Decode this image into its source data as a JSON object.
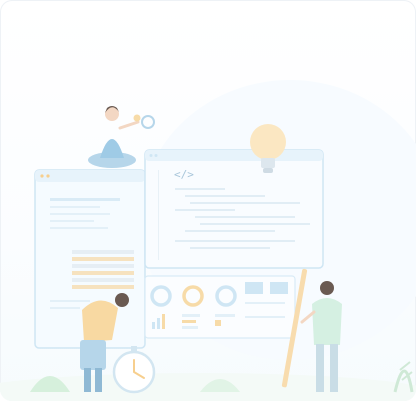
{
  "illustration": {
    "code_glyph": "</>",
    "palette": {
      "window_border": "#cfe6f4",
      "window_fill": "#f5fbff",
      "window_header": "#e7f3fb",
      "accent_orange": "#f7cf8e",
      "accent_teal": "#9fd3e6",
      "skin": "#f3d7c3",
      "hair": "#6a5a52",
      "plant": "#d6f0dc",
      "ground": "#eef7f2"
    }
  }
}
